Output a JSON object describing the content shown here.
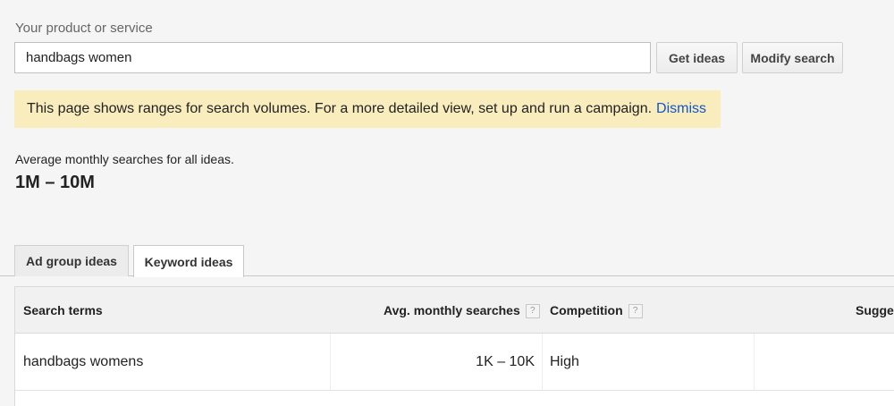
{
  "product": {
    "label": "Your product or service",
    "input_value": "handbags women"
  },
  "buttons": {
    "get_ideas": "Get ideas",
    "modify_search": "Modify search"
  },
  "notice": {
    "text": "This page shows ranges for search volumes. For a more detailed view, set up and run a campaign.",
    "dismiss": "Dismiss",
    "background": "#f9edbe",
    "link_color": "#1155cc"
  },
  "summary": {
    "label": "Average monthly searches for all ideas.",
    "value": "1M – 10M"
  },
  "tabs": [
    {
      "label": "Ad group ideas",
      "active": false
    },
    {
      "label": "Keyword ideas",
      "active": true
    }
  ],
  "table": {
    "columns": {
      "search_terms": "Search terms",
      "avg_monthly": "Avg. monthly searches",
      "competition": "Competition",
      "suggested": "Sugges"
    },
    "help_icon": "?",
    "rows": [
      {
        "term": "handbags womens",
        "avg_monthly": "1K – 10K",
        "competition": "High",
        "suggested": ""
      }
    ]
  }
}
